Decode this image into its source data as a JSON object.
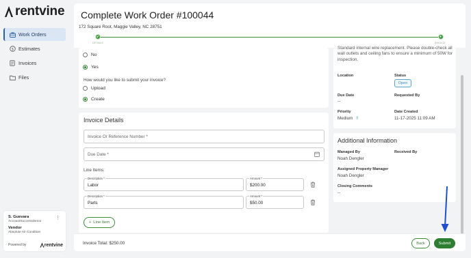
{
  "sidebar": {
    "logo_text": "rentvine",
    "items": [
      {
        "label": "Work Orders",
        "icon": "briefcase-icon",
        "active": true
      },
      {
        "label": "Estimates",
        "icon": "dollar-circle-icon",
        "active": false
      },
      {
        "label": "Invoices",
        "icon": "receipt-icon",
        "active": false
      },
      {
        "label": "Files",
        "icon": "folder-icon",
        "active": false
      }
    ],
    "user": {
      "name": "S. Guevara",
      "account": "AccountSuccessDemo",
      "role": "Vendor",
      "company": "Absolute Air Condition",
      "powered_by": "Powered by",
      "brand": "rentvine"
    }
  },
  "header": {
    "title": "Complete Work Order #100044",
    "address": "172 Square Root, Maggie Valley, NC 28751",
    "steps": [
      "DETAILS",
      "INVOICE"
    ]
  },
  "form": {
    "radio_no": "No",
    "radio_yes": "Yes",
    "submit_question": "How would you like to submit your invoice?",
    "radio_upload": "Upload",
    "radio_create": "Create",
    "invoice_details_title": "Invoice Details",
    "invoice_ref_placeholder": "Invoice Or Reference Number *",
    "due_date_placeholder": "Due Date *",
    "line_items_label": "Line Items:",
    "line_items": [
      {
        "description_label": "Description *",
        "description": "Labor",
        "amount_label": "Amount *",
        "amount": "$200.00"
      },
      {
        "description_label": "Description *",
        "description": "Parts",
        "amount_label": "Amount *",
        "amount": "$50.00"
      }
    ],
    "add_line_item": "Line Item"
  },
  "details": {
    "description": "Standard internal wire replacement. Please double-check all wall outlets and ceiling fans to ensure a minimum of 50W for inspection.",
    "location_label": "Location",
    "status_label": "Status",
    "status_value": "Open",
    "due_date_label": "Due Date",
    "due_date_value": "--",
    "requested_by_label": "Requested By",
    "priority_label": "Priority",
    "priority_value": "Medium",
    "priority_mark": "!!",
    "date_created_label": "Date Created",
    "date_created_value": "11-17-2025 11:09 AM"
  },
  "additional": {
    "title": "Additional Information",
    "managed_by_label": "Managed By",
    "managed_by_value": "Noah Dengler",
    "received_by_label": "Received By",
    "apm_label": "Assigned Property Manager",
    "apm_value": "Noah Dengler",
    "closing_comments_label": "Closing Comments",
    "closing_comments_value": "--"
  },
  "footer": {
    "total": "Invoice Total: $250.00",
    "back": "Back",
    "submit": "Submit"
  },
  "colors": {
    "accent_green": "#2d7d32",
    "nav_active_bg": "#dbe6f4",
    "status_blue": "#4b8fb3",
    "annotation_arrow": "#1f4fcf"
  }
}
